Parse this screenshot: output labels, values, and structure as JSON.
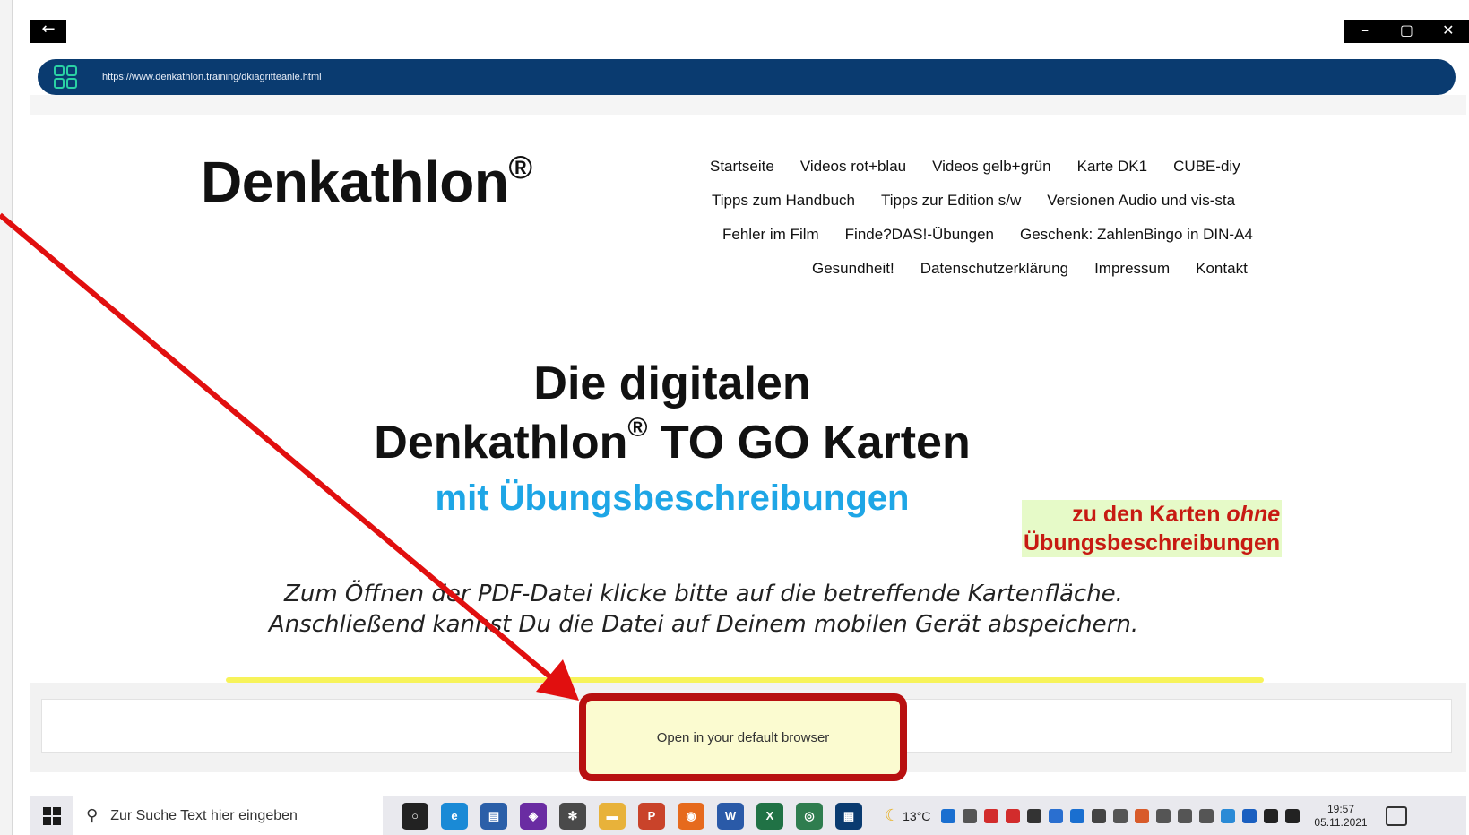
{
  "window": {
    "back_label": "←",
    "controls": [
      "–",
      "▢",
      "✕"
    ]
  },
  "urlbar": {
    "url": "https://www.denkathlon.training/dkiagritteanle.html"
  },
  "site": {
    "logo": "Denkathlon",
    "logo_mark": "®",
    "nav": {
      "row1": [
        "Startseite",
        "Videos rot+blau",
        "Videos gelb+grün",
        "Karte DK1",
        "CUBE-diy"
      ],
      "row2": [
        "Tipps zum Handbuch",
        "Tipps zur Edition s/w",
        "Versionen Audio und vis-sta"
      ],
      "row3": [
        "Fehler im Film",
        "Finde?DAS!-Übungen",
        "Geschenk: ZahlenBingo in DIN-A4"
      ],
      "row4": [
        "Gesundheit!",
        "Datenschutzerklärung",
        "Impressum",
        "Kontakt"
      ]
    },
    "hero_line1": "Die digitalen",
    "hero_line2_a": "Denkathlon",
    "hero_line2_mark": "®",
    "hero_line2_b": " TO GO Karten",
    "hero_sub": "mit Übungsbeschreibungen",
    "other_link_a": "zu den Karten ",
    "other_link_em": "ohne",
    "other_link_b": "Übungsbeschreibungen",
    "instruction_line1": "Zum Öffnen der PDF-Datei klicke bitte auf die betreffende Kartenfläche.",
    "instruction_line2": "Anschließend kannst Du die Datei auf Deinem mobilen Gerät abspeichern."
  },
  "notification": {
    "open_label": "Open in your default browser"
  },
  "taskbar": {
    "search_placeholder": "Zur Suche Text hier eingeben",
    "weather": "13°C",
    "time": "19:57",
    "date": "05.11.2021",
    "apps": [
      {
        "name": "cortana-icon",
        "color": "#222222",
        "glyph": "○"
      },
      {
        "name": "edge-icon",
        "color": "#1a8ad6",
        "glyph": "e"
      },
      {
        "name": "store-icon",
        "color": "#2b5fa8",
        "glyph": "▤"
      },
      {
        "name": "visual-studio-icon",
        "color": "#6a2ca2",
        "glyph": "◈"
      },
      {
        "name": "settings-app-icon",
        "color": "#4a4a4a",
        "glyph": "✻"
      },
      {
        "name": "file-explorer-icon",
        "color": "#e8b23a",
        "glyph": "▬"
      },
      {
        "name": "powerpoint-icon",
        "color": "#c9432a",
        "glyph": "P"
      },
      {
        "name": "firefox-icon",
        "color": "#e66a1d",
        "glyph": "◉"
      },
      {
        "name": "word-icon",
        "color": "#2a5aa8",
        "glyph": "W"
      },
      {
        "name": "excel-icon",
        "color": "#207245",
        "glyph": "X"
      },
      {
        "name": "camera-app-icon",
        "color": "#2f7d4f",
        "glyph": "◎"
      },
      {
        "name": "qr-app-icon",
        "color": "#0a3b70",
        "glyph": "▦"
      }
    ],
    "tray_colors": [
      "#1a6fd0",
      "#555555",
      "#d22c2c",
      "#d22c2c",
      "#333333",
      "#2a6fd0",
      "#1a6fd0",
      "#444444",
      "#555555",
      "#d85b2a",
      "#555555",
      "#555555",
      "#555555",
      "#2a8ad6",
      "#1a5fc0",
      "#222222",
      "#222222"
    ]
  }
}
